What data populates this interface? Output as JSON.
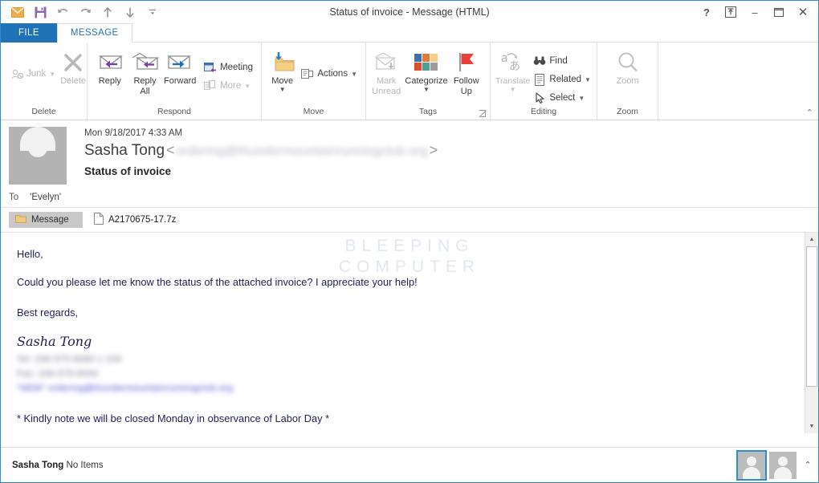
{
  "window": {
    "title": "Status of invoice - Message (HTML)",
    "quick_access": [
      {
        "name": "message-icon",
        "label": "Message"
      },
      {
        "name": "save-icon",
        "label": "Save"
      },
      {
        "name": "undo-icon",
        "label": "Undo"
      },
      {
        "name": "redo-icon",
        "label": "Redo"
      },
      {
        "name": "previous-item-icon",
        "label": "Previous Item"
      },
      {
        "name": "next-item-icon",
        "label": "Next Item"
      },
      {
        "name": "customize-qat-icon",
        "label": "Customize Quick Access Toolbar"
      }
    ],
    "controls": {
      "help": "?",
      "ribbon_display": "⏏",
      "minimize": "–",
      "maximize": "☐",
      "close": "✕"
    }
  },
  "tabs": [
    {
      "label": "FILE",
      "active": false,
      "style": "file"
    },
    {
      "label": "MESSAGE",
      "active": true,
      "style": "normal"
    }
  ],
  "ribbon": {
    "groups": [
      {
        "label": "Delete",
        "items": [
          {
            "label": "Junk",
            "type": "small",
            "icon": "junk-icon",
            "caret": true,
            "disabled": true
          },
          {
            "label": "Delete",
            "type": "big",
            "icon": "delete-x-icon",
            "caret": false,
            "disabled": true
          }
        ]
      },
      {
        "label": "Respond",
        "items": [
          {
            "label": "Reply",
            "type": "big",
            "icon": "reply-icon",
            "caret": false,
            "disabled": false
          },
          {
            "label": "Reply All",
            "type": "big",
            "icon": "reply-all-icon",
            "caret": false,
            "disabled": false
          },
          {
            "label": "Forward",
            "type": "big",
            "icon": "forward-icon",
            "caret": false,
            "disabled": false
          },
          {
            "label": "Meeting",
            "type": "small",
            "icon": "meeting-icon",
            "caret": false,
            "disabled": false
          },
          {
            "label": "More",
            "type": "small",
            "icon": "more-icon",
            "caret": true,
            "disabled": true
          }
        ]
      },
      {
        "label": "Move",
        "items": [
          {
            "label": "Move",
            "type": "big",
            "icon": "move-folder-icon",
            "caret": true,
            "disabled": false
          },
          {
            "label": "Actions",
            "type": "small",
            "icon": "actions-icon",
            "caret": true,
            "disabled": false
          }
        ]
      },
      {
        "label": "Tags",
        "dialog_launcher": true,
        "items": [
          {
            "label": "Mark Unread",
            "type": "big",
            "icon": "mark-unread-icon",
            "caret": false,
            "disabled": true
          },
          {
            "label": "Categorize",
            "type": "big",
            "icon": "categorize-icon",
            "caret": true,
            "disabled": false
          },
          {
            "label": "Follow Up",
            "type": "big",
            "icon": "follow-up-flag-icon",
            "caret": true,
            "disabled": false
          }
        ]
      },
      {
        "label": "Editing",
        "items": [
          {
            "label": "Translate",
            "type": "big",
            "icon": "translate-icon",
            "caret": true,
            "disabled": true
          },
          {
            "label": "Find",
            "type": "small",
            "icon": "find-binoculars-icon",
            "caret": false,
            "disabled": false
          },
          {
            "label": "Related",
            "type": "small",
            "icon": "related-icon",
            "caret": true,
            "disabled": false
          },
          {
            "label": "Select",
            "type": "small",
            "icon": "select-cursor-icon",
            "caret": true,
            "disabled": false
          }
        ]
      },
      {
        "label": "Zoom",
        "items": [
          {
            "label": "Zoom",
            "type": "big",
            "icon": "zoom-magnifier-icon",
            "caret": false,
            "disabled": true
          }
        ]
      }
    ],
    "collapse_label": "⌃"
  },
  "message": {
    "date": "Mon 9/18/2017 4:33 AM",
    "sender_name": "Sasha Tong",
    "sender_email_redacted": "ordering@thundermountainrunningclub.org",
    "angle_open": "<",
    "angle_close": ">",
    "subject": "Status of invoice",
    "to_label": "To",
    "to_value": "'Evelyn'",
    "attachments": {
      "message_tab_label": "Message",
      "files": [
        {
          "name": "A2170675-17.7z"
        }
      ]
    },
    "body": {
      "greeting": "Hello,",
      "paragraph": "Could you please let me know the status of the attached invoice? I appreciate your help!",
      "closing": "Best regards,",
      "signature_name": "Sasha Tong",
      "signature_lines": [
        "Tel: 206-575-8080 x 109",
        "Fax: 206-575-8094",
        "\"NEW\"  ordering@thundermountainrunningclub.org"
      ],
      "footer_note": "* Kindly note we will be closed Monday in observance of Labor Day *"
    },
    "watermark_line1": "BLEEPING",
    "watermark_line2": "COMPUTER"
  },
  "statusbar": {
    "person": "Sasha Tong",
    "items": "No Items",
    "expand_caret": "⌃"
  },
  "colors": {
    "accent_blue": "#1f72b5",
    "window_border": "#2e8ccf",
    "tab_text": "#2b6fad",
    "body_text": "#21215a",
    "flag_red": "#e8403a",
    "folder_tan": "#f3c97b"
  }
}
